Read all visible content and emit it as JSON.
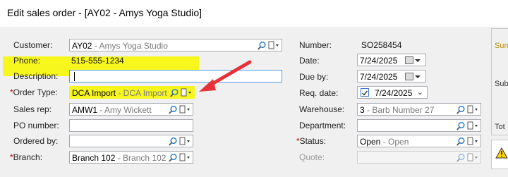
{
  "window": {
    "title": "Edit sales order - [AY02 - Amys Yoga Studio]"
  },
  "left": {
    "customer": {
      "label": "Customer:",
      "code": "AY02",
      "desc": " - Amys Yoga Studio"
    },
    "phone": {
      "label": "Phone:",
      "value": "515-555-1234"
    },
    "description": {
      "label": "Description:",
      "value": ""
    },
    "order_type": {
      "label": "Order Type:",
      "req": "*",
      "code": "DCA Import",
      "desc": " - DCA Import"
    },
    "sales_rep": {
      "label": "Sales rep:",
      "code": "AMW1",
      "desc": " - Amy Wickett"
    },
    "po_number": {
      "label": "PO number:",
      "value": ""
    },
    "ordered_by": {
      "label": "Ordered by:",
      "value": ""
    },
    "branch": {
      "label": "Branch:",
      "req": "*",
      "code": "Branch 102",
      "desc": " - Branch 102"
    }
  },
  "right": {
    "number": {
      "label": "Number:",
      "value": "SO258454"
    },
    "date": {
      "label": "Date:",
      "value": "7/24/2025"
    },
    "due_by": {
      "label": "Due by:",
      "value": "7/24/2025"
    },
    "req_date": {
      "label": "Req. date:",
      "value": "7/24/2025"
    },
    "warehouse": {
      "label": "Warehouse:",
      "code": "3",
      "desc": " - Barb Number 27"
    },
    "department": {
      "label": "Department:",
      "value": ""
    },
    "status": {
      "label": "Status:",
      "req": "*",
      "code": "Open",
      "desc": " - Open"
    },
    "quote": {
      "label": "Quote:",
      "value": ""
    }
  },
  "side_panel": {
    "lines": [
      "Sum",
      "Sub",
      "Tot"
    ]
  },
  "colors": {
    "highlight": "#f7f71e",
    "arrow": "#e8323a",
    "required": "#c00000"
  }
}
